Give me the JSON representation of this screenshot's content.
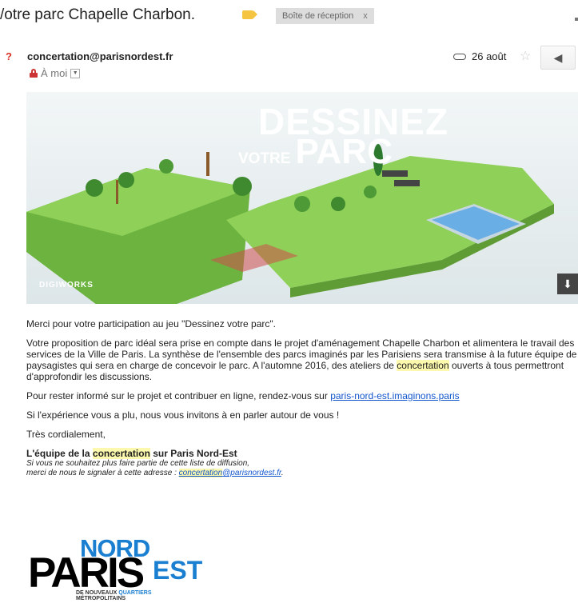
{
  "email": {
    "subject": "/otre parc Chapelle Charbon.",
    "inbox_label": "Boîte de réception",
    "inbox_close": "x",
    "sender": "concertation@parisnordest.fr",
    "avatar": "?",
    "to": "À moi",
    "date": "26 août"
  },
  "banner": {
    "line1": "DESSINEZ",
    "line2_small": "VOTRE",
    "line2_big": "PARC",
    "brand": "DIGIWORKS"
  },
  "body": {
    "p1": "Merci pour votre participation au jeu \"Dessinez votre parc\".",
    "p2a": "Votre proposition de parc idéal sera prise en compte dans le projet d'aménagement Chapelle Charbon et alimentera le travail des services de la Ville de Paris. La synthèse de l'ensemble des parcs imaginés par les Parisiens sera transmise à la future équipe de paysagistes qui sera en charge de concevoir le parc. A l'automne 2016, des ateliers de",
    "p2hl": "concertation",
    "p2b": "ouverts à tous permettront d'approfondir les discussions.",
    "p3": "Pour rester informé sur le projet et contribuer en ligne, rendez-vous sur",
    "p3link": "paris-nord-est.imaginons.paris",
    "p4": "Si l'expérience vous a plu, nous vous invitons à en parler autour de vous !",
    "p5": "Très cordialement,",
    "sig_a": "L'équipe de la",
    "sig_hl": "concertation",
    "sig_b": "sur Paris Nord-Est",
    "unsub1": "Si vous ne souhaitez plus faire partie de cette liste de diffusion,",
    "unsub2": "merci de nous le signaler à cette adresse :",
    "unsub_link_hl": "concertation",
    "unsub_link_rest": "@parisnordest.fr",
    "unsub_end": "."
  },
  "logo": {
    "nord": "NORD",
    "paris": "PARIS",
    "est": "EST",
    "tag1a": "DE NOUVEAUX",
    "tag1b": "QUARTIERS",
    "tag2": "MÉTROPOLITAINS"
  },
  "colors": {
    "highlight": "#fcf8ad",
    "link": "#1155cc",
    "brand_blue": "#1a7ed1",
    "grass": "#7cc04b"
  }
}
